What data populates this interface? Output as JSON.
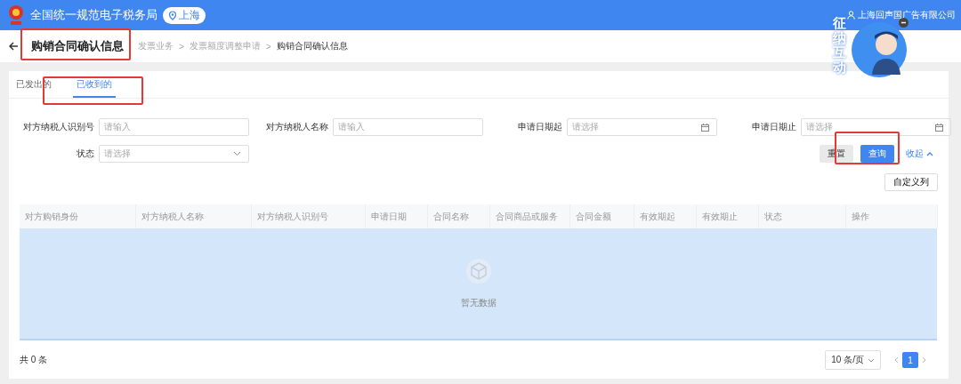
{
  "header": {
    "title": "全国统一规范电子税务局",
    "region": "上海",
    "user": "上海回声国广告有限公司"
  },
  "mascot": {
    "label": "征纳互动"
  },
  "page": {
    "title": "购销合同确认信息",
    "separator": ">",
    "breadcrumbs": [
      "发票业务",
      "发票额度调整申请",
      "购销合同确认信息"
    ]
  },
  "tabs": [
    {
      "label": "已发出的",
      "selected": false
    },
    {
      "label": "已收到的",
      "selected": true
    }
  ],
  "filters": [
    {
      "label": "对方纳税人识别号",
      "kind": "text",
      "placeholder": "请输入"
    },
    {
      "label": "对方纳税人名称",
      "kind": "text",
      "placeholder": "请输入"
    },
    {
      "label": "申请日期起",
      "kind": "date",
      "placeholder": "请选择"
    },
    {
      "label": "申请日期止",
      "kind": "date",
      "placeholder": "请选择"
    },
    {
      "label": "状态",
      "kind": "select",
      "placeholder": "请选择"
    }
  ],
  "actions": {
    "reset": "重置",
    "query": "查询",
    "collapse": "收起",
    "columns": "自定义列"
  },
  "table": {
    "columns": [
      "对方购销身份",
      "对方纳税人名称",
      "对方纳税人识别号",
      "申请日期",
      "合同名称",
      "合同商品或服务",
      "合同金额",
      "有效期起",
      "有效期止",
      "状态",
      "操作"
    ],
    "empty_text": "暂无数据"
  },
  "pagination": {
    "total": "共 0 条",
    "page_size": "10 条/页",
    "pages": [
      {
        "label": "1",
        "selected": true
      }
    ]
  }
}
